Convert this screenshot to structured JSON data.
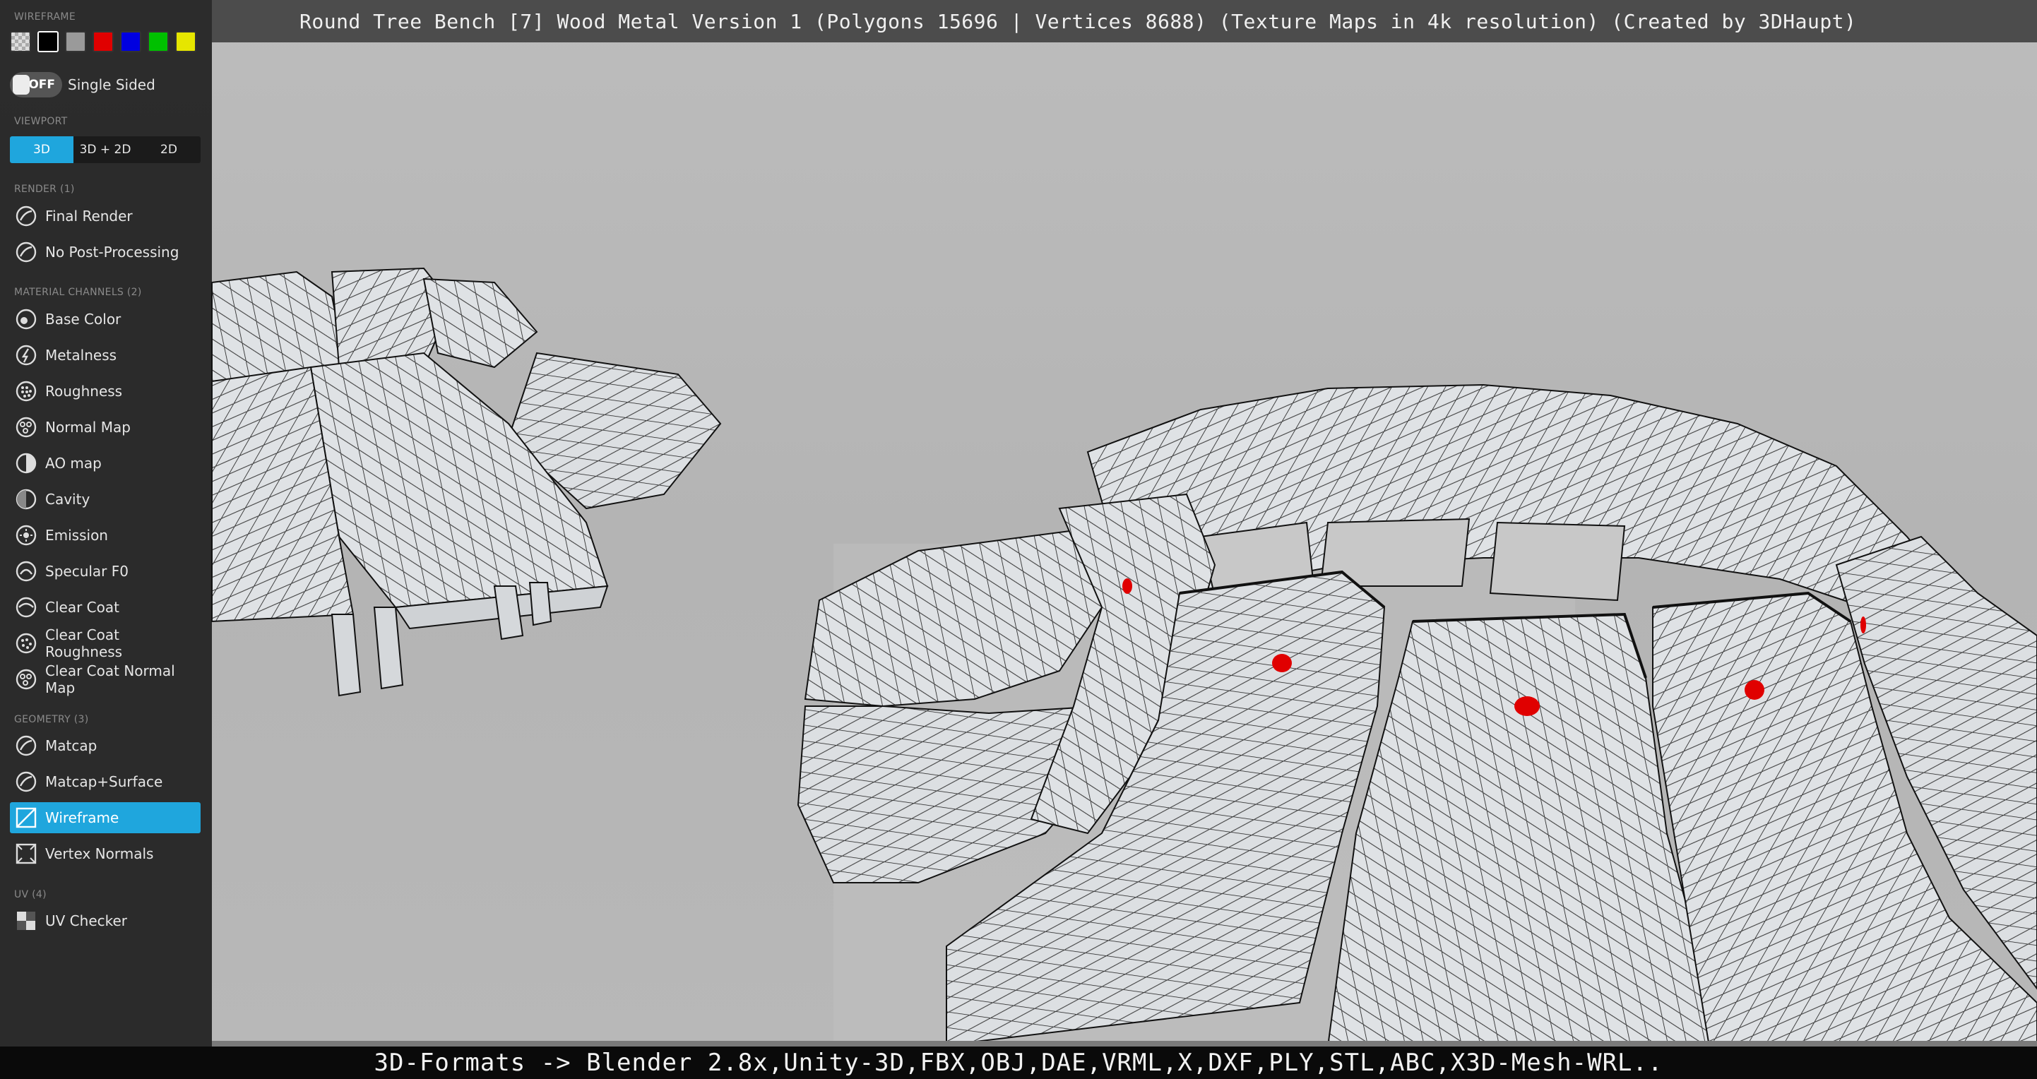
{
  "title_bar": {
    "text": "Round Tree Bench [7] Wood Metal Version 1 (Polygons 15696 | Vertices 8688) (Texture Maps in 4k resolution) (Created by 3DHaupt)"
  },
  "formats_bar": {
    "text": "3D-Formats -> Blender 2.8x,Unity-3D,FBX,OBJ,DAE,VRML,X,DXF,PLY,STL,ABC,X3D-Mesh-WRL.."
  },
  "panel": {
    "wireframe_label": "WIREFRAME",
    "swatches": [
      {
        "name": "transparent",
        "color": "checker"
      },
      {
        "name": "black",
        "color": "#000000"
      },
      {
        "name": "grey",
        "color": "#9a9a9a"
      },
      {
        "name": "red",
        "color": "#e00000"
      },
      {
        "name": "blue",
        "color": "#0000e0"
      },
      {
        "name": "green",
        "color": "#00c000"
      },
      {
        "name": "yellow",
        "color": "#e6e600"
      }
    ],
    "single_sided": {
      "toggle_text": "OFF",
      "label": "Single Sided"
    },
    "viewport": {
      "label": "VIEWPORT",
      "tabs": [
        "3D",
        "3D + 2D",
        "2D"
      ],
      "active": "3D"
    },
    "render": {
      "label": "RENDER (1)",
      "items": [
        "Final Render",
        "No Post-Processing"
      ]
    },
    "material": {
      "label": "MATERIAL CHANNELS (2)",
      "items": [
        {
          "label": "Base Color",
          "icon": "base-color-icon"
        },
        {
          "label": "Metalness",
          "icon": "metalness-icon"
        },
        {
          "label": "Roughness",
          "icon": "roughness-icon"
        },
        {
          "label": "Normal Map",
          "icon": "normal-map-icon"
        },
        {
          "label": "AO map",
          "icon": "ao-map-icon"
        },
        {
          "label": "Cavity",
          "icon": "cavity-icon"
        },
        {
          "label": "Emission",
          "icon": "emission-icon"
        },
        {
          "label": "Specular F0",
          "icon": "specular-icon"
        },
        {
          "label": "Clear Coat",
          "icon": "clear-coat-icon"
        },
        {
          "label": "Clear Coat Roughness",
          "icon": "clear-coat-roughness-icon"
        },
        {
          "label": "Clear Coat Normal Map",
          "icon": "clear-coat-normal-icon"
        }
      ]
    },
    "geometry": {
      "label": "GEOMETRY (3)",
      "items": [
        {
          "label": "Matcap",
          "icon": "matcap-icon"
        },
        {
          "label": "Matcap+Surface",
          "icon": "matcap-surface-icon"
        },
        {
          "label": "Wireframe",
          "icon": "wireframe-icon",
          "active": true
        },
        {
          "label": "Vertex Normals",
          "icon": "vertex-normals-icon"
        }
      ]
    },
    "uv": {
      "label": "UV (4)",
      "items": [
        {
          "label": "UV Checker",
          "icon": "uv-checker-icon"
        }
      ]
    }
  },
  "colors": {
    "accent": "#1fa6dd",
    "panel_bg": "#141414",
    "viewport_bg": "#b9b9b9",
    "marker": "#e00000"
  }
}
